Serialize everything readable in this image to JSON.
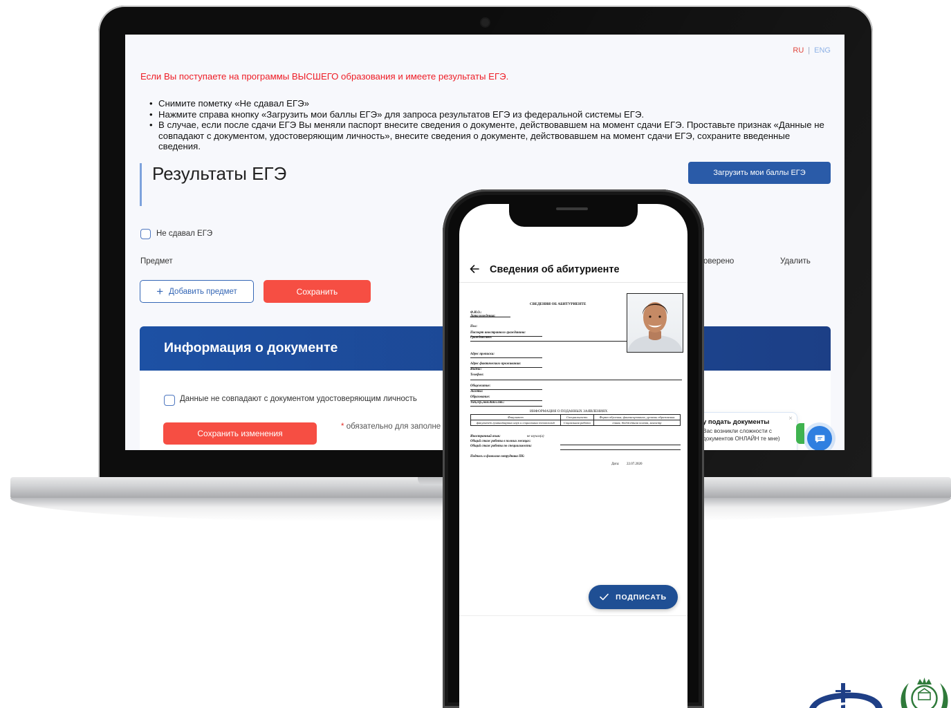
{
  "laptop": {
    "lang": {
      "ru": "RU",
      "separator": "|",
      "eng": "ENG"
    },
    "notice": "Если Вы поступаете на программы ВЫСШЕГО образования и имеете результаты ЕГЭ.",
    "instructions": [
      "Снимите пометку «Не сдавал ЕГЭ»",
      "Нажмите справа кнопку «Загрузить мои баллы ЕГЭ» для запроса результатов ЕГЭ из федеральной системы ЕГЭ.",
      "В случае, если после сдачи ЕГЭ Вы меняли паспорт внесите сведения о документе, действовавшем на момент сдачи ЕГЭ. Проставьте признак «Данные не совпадают с документом, удостоверяющим личность», внесите сведения о документе, действовавшем на момент сдачи ЕГЭ, сохраните введенные сведения."
    ],
    "results_title": "Результаты ЕГЭ",
    "load_scores_label": "Загрузить мои баллы ЕГЭ",
    "no_ege_label": "Не сдавал ЕГЭ",
    "table_headers": {
      "subject": "Предмет",
      "checked": "оверено",
      "delete": "Удалить"
    },
    "add_subject_label": "Добавить предмет",
    "save_label": "Сохранить",
    "doc_section_title": "Информация о документе",
    "mismatch_label": "Данные не совпадают с документом удостоверяющим личность",
    "save_changes_label": "Сохранить изменения",
    "required_note_star": "*",
    "required_note": "обязательно для заполне",
    "chat_popup": {
      "title": "у подать документы",
      "text": "Вас возникли сложности с документов ОНЛАЙН те мне)",
      "close": "×"
    },
    "colors": {
      "accent_red": "#f64e43",
      "primary_blue": "#2a5ba8",
      "header_blue": "#1d51a4"
    }
  },
  "phone": {
    "title": "Сведения об абитуриенте",
    "doc": {
      "heading": "СВЕДЕНИЯ ОБ АБИТУРИЕНТЕ",
      "fio": "Ф.И.О.:",
      "birth_date": "Дата рождения:",
      "sex": "Пол:",
      "foreign_passport": "Паспорт иностранного гражданина:",
      "citizenship": "Гражданство:",
      "registration_address": "Адрес прописки:",
      "actual_address": "Адрес фактического проживания:",
      "index": "Индекс:",
      "phone": "Телефон:",
      "dormitory": "Общежитие:",
      "benefits": "Льготы:",
      "education": "Образование:",
      "education_doc": "Тип,сер.,ном.дипл./ат.:",
      "apps_heading": "ИНФОРМАЦИЯ О ПОДАННЫХ ЗАЯВЛЕНИЯХ",
      "apps_columns": [
        "Факультет",
        "Специальность",
        "Форма обучения, финансирование, уровень образования"
      ],
      "apps_rows": [
        [
          "факультет гуманитарных наук и социальных технологий",
          "Социальная работа",
          "очная, бюджетная основа, магистр"
        ]
      ],
      "foreign_language": "Иностранный язык:",
      "foreign_language_value": "не изучал(а)",
      "work_experience_full": "Общий стаж работы в полных месяцах:",
      "work_experience_specialty": "Общий стаж работы по специальности:",
      "signature": "Подпись и фамилия сотрудника ПК:",
      "date_label": "Дата:",
      "date_value": "22.07.2020"
    },
    "sign_label": "ПОДПИСАТЬ"
  }
}
